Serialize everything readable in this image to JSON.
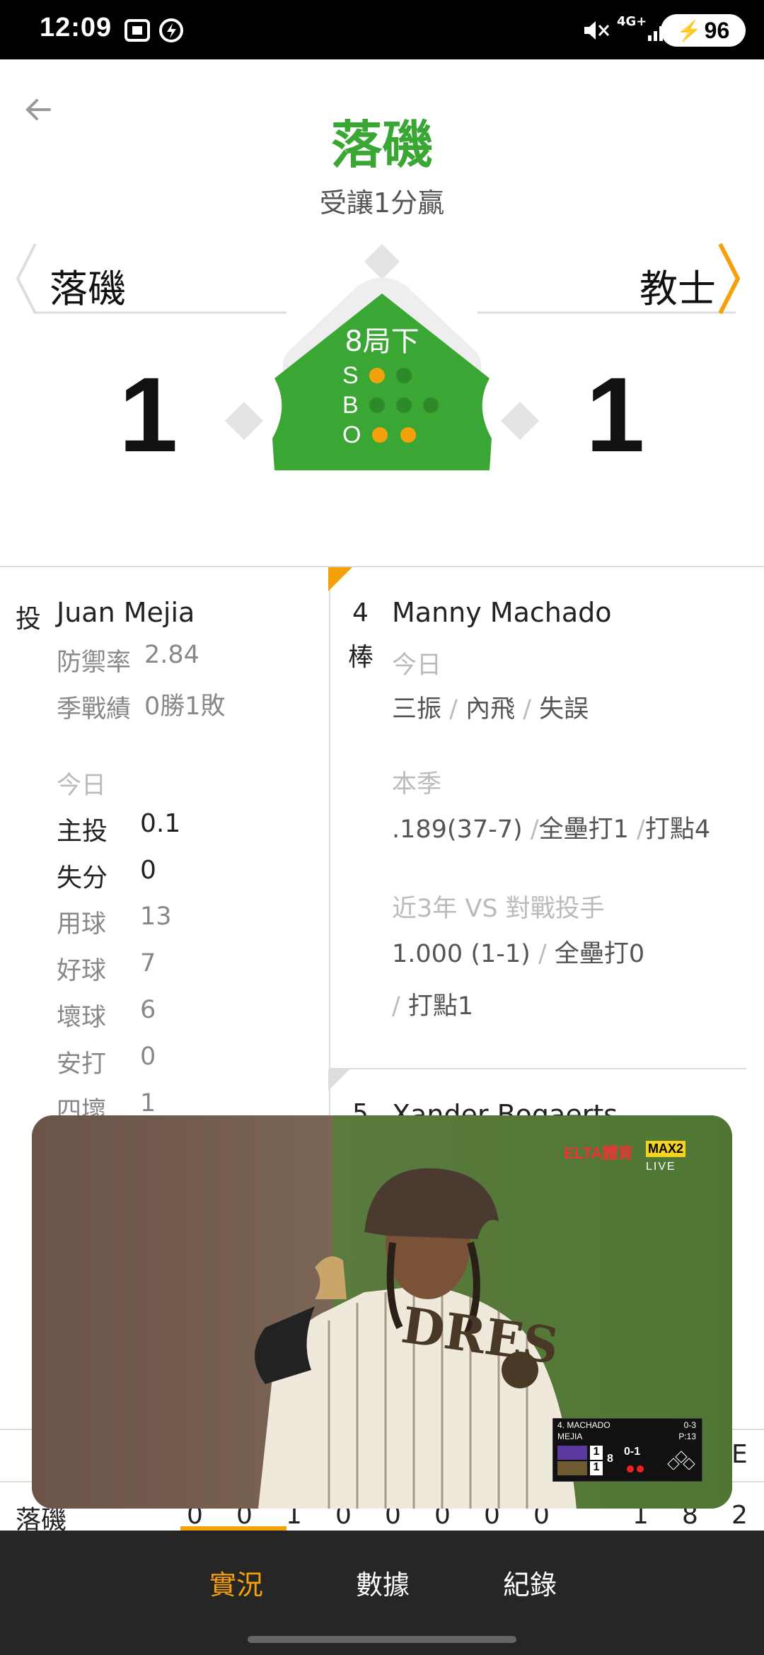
{
  "status_bar": {
    "time": "12:09",
    "battery": "96",
    "network": "4G+"
  },
  "header": {
    "title": "落磯",
    "handicap": "受讓1分贏"
  },
  "scoreboard": {
    "away_team": "落磯",
    "home_team": "教士",
    "away_score": "1",
    "home_score": "1",
    "inning": "8局下",
    "count_labels": [
      "S",
      "B",
      "O"
    ],
    "strikes": 1,
    "balls": 0,
    "outs": 2
  },
  "pitcher": {
    "tag": "投",
    "name": "Juan Mejia",
    "era_label": "防禦率",
    "era": "2.84",
    "record_label": "季戰績",
    "record": "0勝1敗",
    "today_label": "今日",
    "stats": [
      {
        "label": "主投",
        "value": "0.1"
      },
      {
        "label": "失分",
        "value": "0"
      },
      {
        "label": "用球",
        "value": "13"
      },
      {
        "label": "好球",
        "value": "7"
      },
      {
        "label": "壞球",
        "value": "6"
      },
      {
        "label": "安打",
        "value": "0"
      },
      {
        "label": "四壞",
        "value": "1"
      }
    ]
  },
  "batter": {
    "order": "4",
    "order_suffix": "棒",
    "name": "Manny Machado",
    "today_label": "今日",
    "today": [
      "三振",
      "內飛",
      "失誤"
    ],
    "season_label": "本季",
    "season": [
      ".189(37-7)",
      "全壘打1",
      "打點4"
    ],
    "vs_label": "近3年 VS 對戰投手",
    "vs": [
      "1.000 (1-1)",
      "全壘打0",
      "打點1"
    ],
    "next_order": "5",
    "next_name": "Xander Bogaerts"
  },
  "video": {
    "channel_logo": "ELTA體育",
    "channel_sub": "MAX2",
    "live": "LIVE",
    "overlay": {
      "batter": "4. MACHADO",
      "batter_line": "0-3",
      "pitcher": "MEJIA",
      "pitches": "P:13",
      "away_score": "1",
      "home_score": "1",
      "inning": "8",
      "count": "0-1"
    }
  },
  "line_score": {
    "team": "落磯",
    "innings": [
      "0",
      "0",
      "1",
      "0",
      "0",
      "0",
      "0",
      "0"
    ],
    "r": "1",
    "h": "8",
    "e": "2",
    "e_header": "E"
  },
  "bottom_nav": {
    "tabs": [
      {
        "label": "實況",
        "active": true
      },
      {
        "label": "數據",
        "active": false
      },
      {
        "label": "紀錄",
        "active": false
      }
    ]
  },
  "colors": {
    "accent": "#f5a10b",
    "green": "#3aa734",
    "nav_bg": "#262626"
  }
}
